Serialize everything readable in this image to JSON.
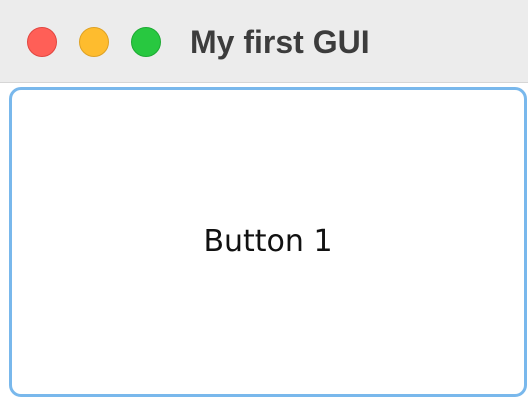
{
  "window": {
    "title": "My first GUI",
    "controls": {
      "close_color": "#ff5f57",
      "minimize_color": "#febc2e",
      "zoom_color": "#28c840"
    }
  },
  "content": {
    "button_label": "Button 1",
    "button_border_color": "#79b8ec"
  }
}
